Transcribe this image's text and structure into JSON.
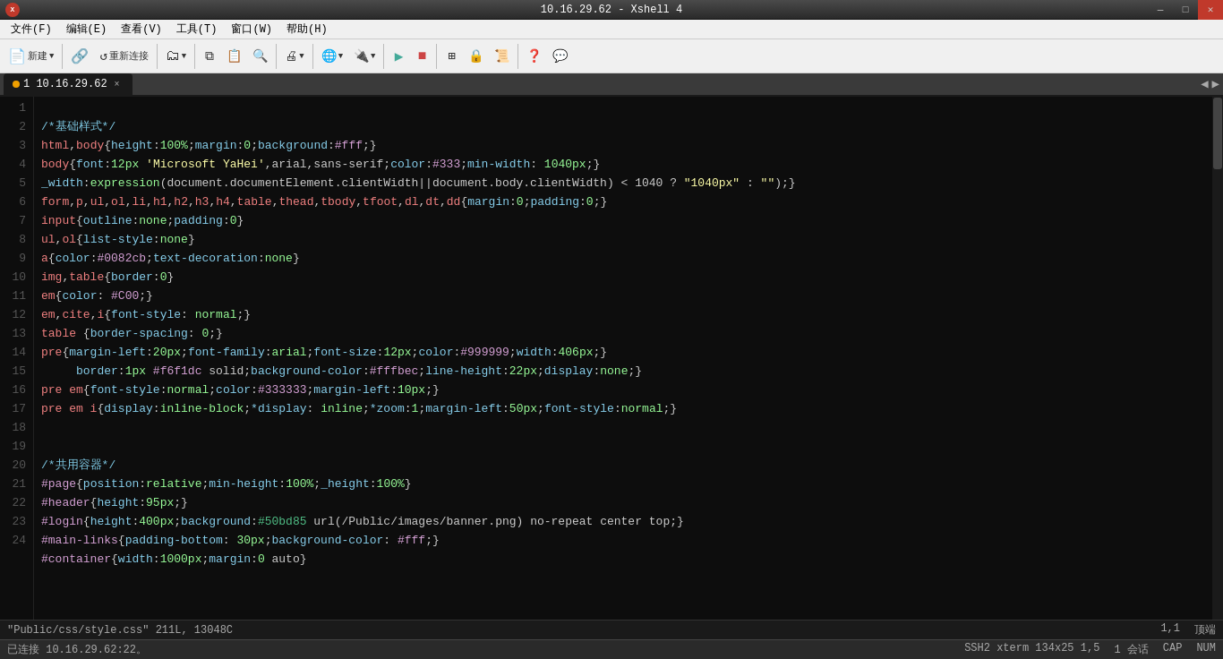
{
  "titlebar": {
    "title": "10.16.29.62 - Xshell 4",
    "logo": "X",
    "btn_min": "—",
    "btn_max": "□",
    "btn_close": "✕"
  },
  "menubar": {
    "items": [
      {
        "label": "文件(F)"
      },
      {
        "label": "编辑(E)"
      },
      {
        "label": "查看(V)"
      },
      {
        "label": "工具(T)"
      },
      {
        "label": "窗口(W)"
      },
      {
        "label": "帮助(H)"
      }
    ]
  },
  "toolbar": {
    "new_label": "新建",
    "reconnect_label": "重新连接"
  },
  "tab": {
    "dot_color": "#f0a000",
    "label": "1 10.16.29.62",
    "close": "×"
  },
  "statusbar": {
    "file": "\"Public/css/style.css\" 211L, 13048C",
    "pos": "1,1",
    "top": "顶端"
  },
  "connbar": {
    "status": "已连接 10.16.29.62:22。",
    "ssh": "SSH2 xterm 134x25 1,5",
    "sessions": "1 会话",
    "cap": "CAP",
    "num": "NUM"
  }
}
